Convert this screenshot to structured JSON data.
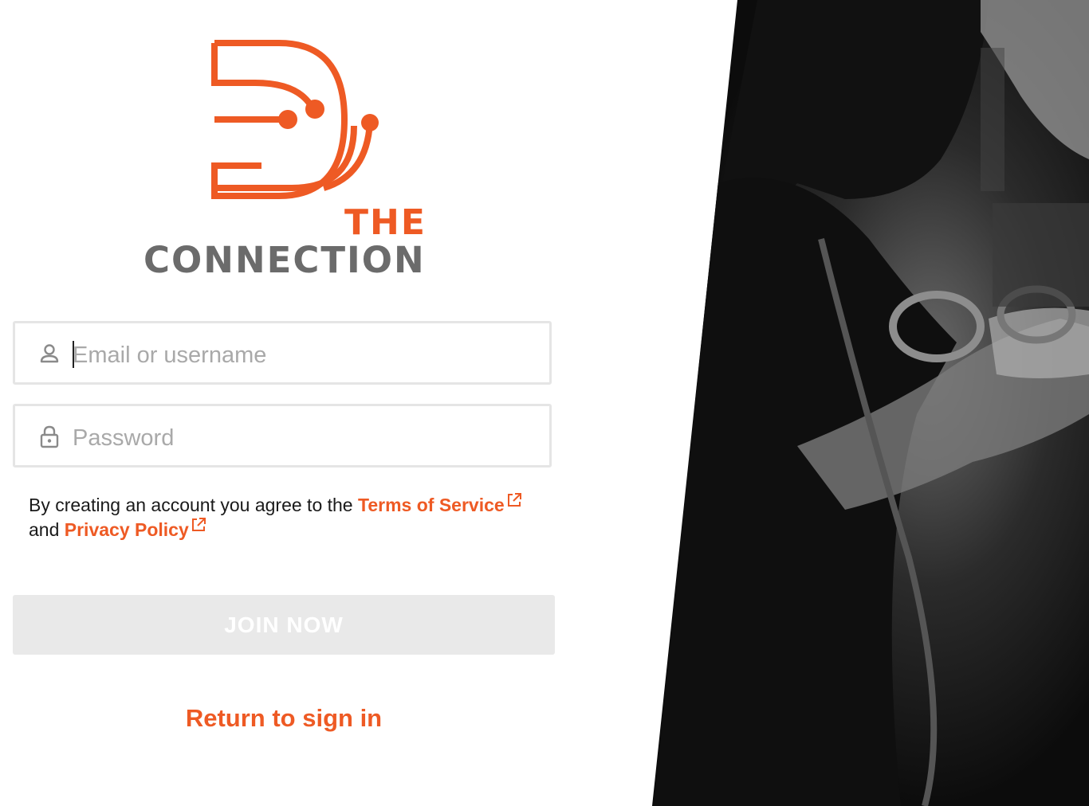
{
  "brand": {
    "logo_word_top": "THE",
    "logo_word_bottom": "CONNECTION",
    "accent_color": "#ee5a24",
    "gray_color": "#666666"
  },
  "form": {
    "email": {
      "placeholder": "Email or username",
      "value": "",
      "icon": "user-icon"
    },
    "password": {
      "placeholder": "Password",
      "value": "",
      "icon": "lock-icon"
    }
  },
  "legal": {
    "prefix": "By creating an account you agree to the",
    "terms_label": "Terms of Service",
    "middle": "and",
    "privacy_label": "Privacy Policy",
    "link_icon": "external-link-icon"
  },
  "actions": {
    "join_label": "JOIN NOW",
    "return_label": "Return to sign in"
  },
  "hero": {
    "description_icon": "photo"
  }
}
